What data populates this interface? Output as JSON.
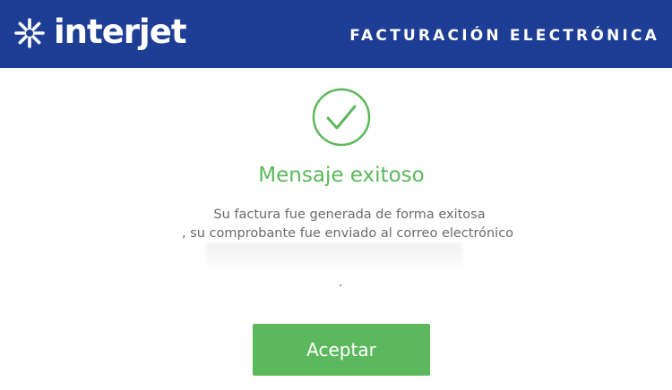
{
  "header": {
    "brand_text": "interjet",
    "title": "FACTURACIÓN ELECTRÓNICA",
    "background_color": "#1e3d94",
    "logo_icon": "asterisk-star-icon"
  },
  "dialog": {
    "status_icon": "check-circle-icon",
    "title": "Mensaje exitoso",
    "line1": "Su factura fue generada de forma exitosa",
    "line2": ", su comprobante fue enviado al correo electrónico",
    "trailing_text": ".",
    "accept_label": "Aceptar",
    "accent_color": "#5cb85c"
  }
}
